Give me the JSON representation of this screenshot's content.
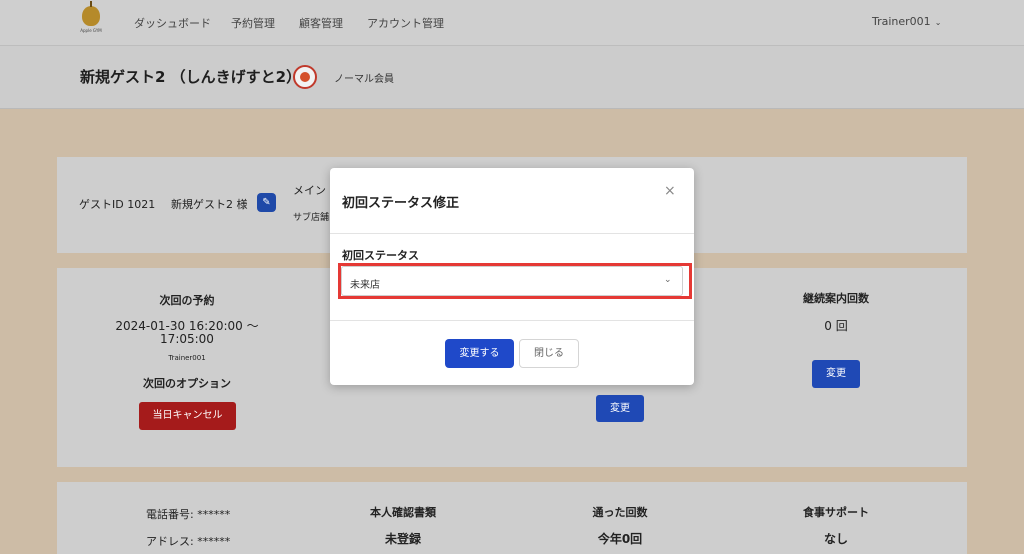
{
  "nav": {
    "logo_text": "Apple GYM",
    "items": [
      "ダッシュボード",
      "予約管理",
      "顧客管理",
      "アカウント管理"
    ],
    "user": "Trainer001"
  },
  "header": {
    "guest_name": "新規ゲスト2 （しんきげすと2）",
    "member_type": "ノーマル会員"
  },
  "guest_info": {
    "id_label": "ゲストID 1021",
    "name_label": "新規ゲスト2 様",
    "main_label": "メイン",
    "sub_label": "サブ店舗"
  },
  "stats": {
    "next_booking_title": "次回の予約",
    "next_booking_datetime_line1": "2024-01-30 16:20:00 〜",
    "next_booking_datetime_line2": "17:05:00",
    "next_booking_trainer": "Trainer001",
    "next_option_title": "次回のオプション",
    "cancel_button": "当日キャンセル",
    "middle_change_button": "変更",
    "continuation_title": "継続案内回数",
    "continuation_value": "0 回",
    "continuation_change_button": "変更"
  },
  "details": {
    "phone": "電話番号: ******",
    "address": "アドレス: ******",
    "id_doc_title": "本人確認書類",
    "id_doc_value": "未登録",
    "visits_title": "通った回数",
    "visits_value": "今年0回",
    "meal_title": "食事サポート",
    "meal_value": "なし"
  },
  "modal": {
    "title": "初回ステータス修正",
    "close_glyph": "×",
    "field_label": "初回ステータス",
    "select_value": "未来店",
    "submit_button": "変更する",
    "close_button": "閉じる"
  }
}
